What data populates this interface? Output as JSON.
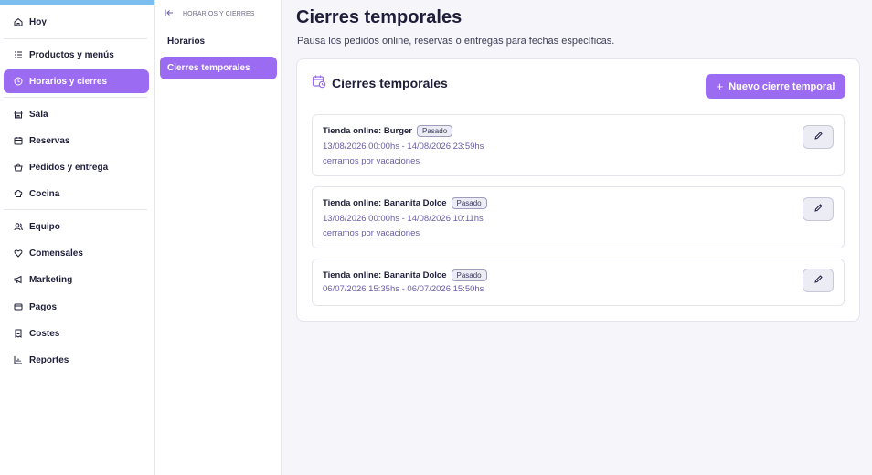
{
  "sidebar": {
    "items": [
      {
        "label": "Hoy",
        "icon": "home-icon"
      },
      {
        "label": "Productos y menús",
        "icon": "list-icon"
      },
      {
        "label": "Horarios y cierres",
        "icon": "clock-icon"
      },
      {
        "label": "Sala",
        "icon": "store-icon"
      },
      {
        "label": "Reservas",
        "icon": "calendar-icon"
      },
      {
        "label": "Pedidos y entrega",
        "icon": "basket-icon"
      },
      {
        "label": "Cocina",
        "icon": "chef-hat-icon"
      },
      {
        "label": "Equipo",
        "icon": "users-icon"
      },
      {
        "label": "Comensales",
        "icon": "heart-icon"
      },
      {
        "label": "Marketing",
        "icon": "megaphone-icon"
      },
      {
        "label": "Pagos",
        "icon": "card-icon"
      },
      {
        "label": "Costes",
        "icon": "receipt-icon"
      },
      {
        "label": "Reportes",
        "icon": "chart-icon"
      }
    ]
  },
  "subnav": {
    "header": "HORARIOS Y CIERRES",
    "items": [
      {
        "label": "Horarios"
      },
      {
        "label": "Cierres temporales"
      }
    ]
  },
  "page": {
    "title": "Cierres temporales",
    "subtitle": "Pausa los pedidos online, reservas o entregas para fechas específicas."
  },
  "card": {
    "title": "Cierres temporales",
    "new_button": "Nuevo cierre temporal",
    "closures": [
      {
        "name": "Tienda online: Burger",
        "status": "Pasado",
        "dates": "13/08/2026 00:00hs - 14/08/2026 23:59hs",
        "note": "cerramos por vacaciones"
      },
      {
        "name": "Tienda online: Bananita Dolce",
        "status": "Pasado",
        "dates": "13/08/2026 00:00hs - 14/08/2026 10:11hs",
        "note": "cerramos por vacaciones"
      },
      {
        "name": "Tienda online: Bananita Dolce",
        "status": "Pasado",
        "dates": "06/07/2026 15:35hs - 06/07/2026 15:50hs",
        "note": ""
      }
    ]
  },
  "colors": {
    "accent": "#9b6cf2",
    "top_strip": "#7dbef0",
    "date_text": "#6a5ea8"
  }
}
